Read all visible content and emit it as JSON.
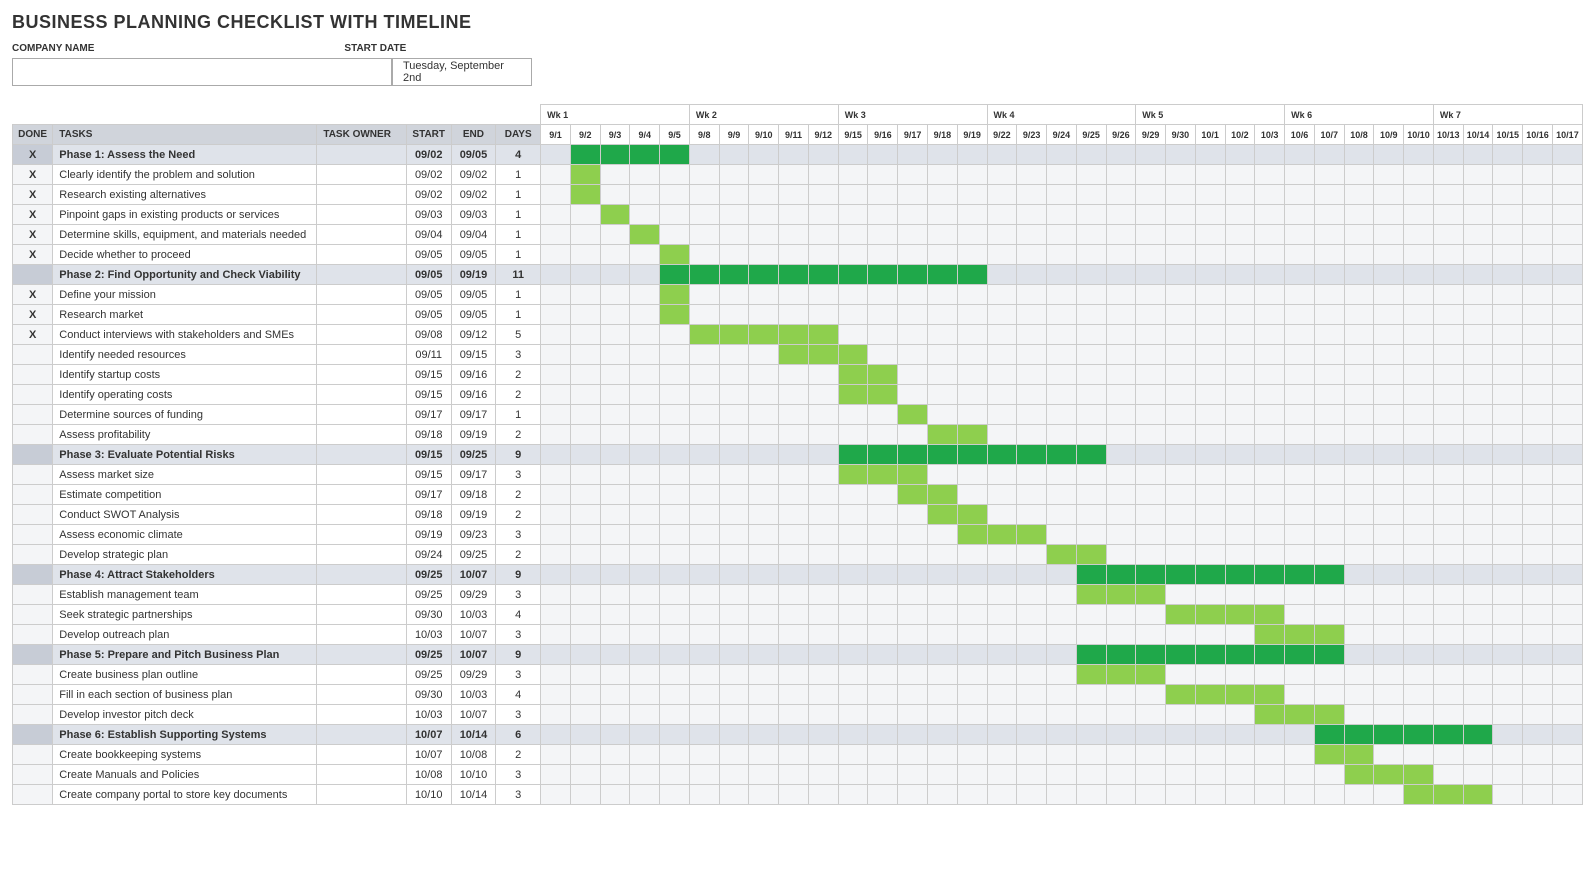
{
  "title": "BUSINESS PLANNING CHECKLIST WITH TIMELINE",
  "meta": {
    "company_label": "COMPANY NAME",
    "company_value": "",
    "startdate_label": "START DATE",
    "startdate_value": "Tuesday, September 2nd"
  },
  "headers": {
    "done": "DONE",
    "tasks": "TASKS",
    "owner": "TASK OWNER",
    "start": "START",
    "end": "END",
    "days": "DAYS"
  },
  "weeks": [
    {
      "label": "Wk 1",
      "days": [
        "9/1",
        "9/2",
        "9/3",
        "9/4",
        "9/5"
      ]
    },
    {
      "label": "Wk 2",
      "days": [
        "9/8",
        "9/9",
        "9/10",
        "9/11",
        "9/12"
      ]
    },
    {
      "label": "Wk 3",
      "days": [
        "9/15",
        "9/16",
        "9/17",
        "9/18",
        "9/19"
      ]
    },
    {
      "label": "Wk 4",
      "days": [
        "9/22",
        "9/23",
        "9/24",
        "9/25",
        "9/26"
      ]
    },
    {
      "label": "Wk 5",
      "days": [
        "9/29",
        "9/30",
        "10/1",
        "10/2",
        "10/3"
      ]
    },
    {
      "label": "Wk 6",
      "days": [
        "10/6",
        "10/7",
        "10/8",
        "10/9",
        "10/10"
      ]
    },
    {
      "label": "Wk 7",
      "days": [
        "10/13",
        "10/14",
        "10/15",
        "10/16",
        "10/17"
      ]
    }
  ],
  "all_days": [
    "9/1",
    "9/2",
    "9/3",
    "9/4",
    "9/5",
    "9/8",
    "9/9",
    "9/10",
    "9/11",
    "9/12",
    "9/15",
    "9/16",
    "9/17",
    "9/18",
    "9/19",
    "9/22",
    "9/23",
    "9/24",
    "9/25",
    "9/26",
    "9/29",
    "9/30",
    "10/1",
    "10/2",
    "10/3",
    "10/6",
    "10/7",
    "10/8",
    "10/9",
    "10/10",
    "10/13",
    "10/14",
    "10/15",
    "10/16",
    "10/17"
  ],
  "rows": [
    {
      "phase": true,
      "done": "X",
      "task": "Phase 1: Assess the Need",
      "owner": "",
      "start": "09/02",
      "end": "09/05",
      "days": "4",
      "bar_from": "9/2",
      "bar_to": "9/5"
    },
    {
      "phase": false,
      "done": "X",
      "task": "Clearly identify the problem and solution",
      "owner": "",
      "start": "09/02",
      "end": "09/02",
      "days": "1",
      "bar_from": "9/2",
      "bar_to": "9/2"
    },
    {
      "phase": false,
      "done": "X",
      "task": "Research existing alternatives",
      "owner": "",
      "start": "09/02",
      "end": "09/02",
      "days": "1",
      "bar_from": "9/2",
      "bar_to": "9/2"
    },
    {
      "phase": false,
      "done": "X",
      "task": "Pinpoint gaps in existing products or services",
      "owner": "",
      "start": "09/03",
      "end": "09/03",
      "days": "1",
      "bar_from": "9/3",
      "bar_to": "9/3"
    },
    {
      "phase": false,
      "done": "X",
      "task": "Determine skills, equipment, and materials needed",
      "owner": "",
      "start": "09/04",
      "end": "09/04",
      "days": "1",
      "bar_from": "9/4",
      "bar_to": "9/4"
    },
    {
      "phase": false,
      "done": "X",
      "task": "Decide whether to proceed",
      "owner": "",
      "start": "09/05",
      "end": "09/05",
      "days": "1",
      "bar_from": "9/5",
      "bar_to": "9/5"
    },
    {
      "phase": true,
      "done": "",
      "task": "Phase 2: Find Opportunity and Check Viability",
      "owner": "",
      "start": "09/05",
      "end": "09/19",
      "days": "11",
      "bar_from": "9/5",
      "bar_to": "9/19"
    },
    {
      "phase": false,
      "done": "X",
      "task": "Define your mission",
      "owner": "",
      "start": "09/05",
      "end": "09/05",
      "days": "1",
      "bar_from": "9/5",
      "bar_to": "9/5"
    },
    {
      "phase": false,
      "done": "X",
      "task": "Research market",
      "owner": "",
      "start": "09/05",
      "end": "09/05",
      "days": "1",
      "bar_from": "9/5",
      "bar_to": "9/5"
    },
    {
      "phase": false,
      "done": "X",
      "task": "Conduct interviews with stakeholders and SMEs",
      "owner": "",
      "start": "09/08",
      "end": "09/12",
      "days": "5",
      "bar_from": "9/8",
      "bar_to": "9/12"
    },
    {
      "phase": false,
      "done": "",
      "task": "Identify needed resources",
      "owner": "",
      "start": "09/11",
      "end": "09/15",
      "days": "3",
      "bar_from": "9/11",
      "bar_to": "9/15"
    },
    {
      "phase": false,
      "done": "",
      "task": "Identify startup costs",
      "owner": "",
      "start": "09/15",
      "end": "09/16",
      "days": "2",
      "bar_from": "9/15",
      "bar_to": "9/16"
    },
    {
      "phase": false,
      "done": "",
      "task": "Identify operating costs",
      "owner": "",
      "start": "09/15",
      "end": "09/16",
      "days": "2",
      "bar_from": "9/15",
      "bar_to": "9/16"
    },
    {
      "phase": false,
      "done": "",
      "task": "Determine sources of funding",
      "owner": "",
      "start": "09/17",
      "end": "09/17",
      "days": "1",
      "bar_from": "9/17",
      "bar_to": "9/17"
    },
    {
      "phase": false,
      "done": "",
      "task": "Assess profitability",
      "owner": "",
      "start": "09/18",
      "end": "09/19",
      "days": "2",
      "bar_from": "9/18",
      "bar_to": "9/19"
    },
    {
      "phase": true,
      "done": "",
      "task": "Phase 3: Evaluate Potential Risks",
      "owner": "",
      "start": "09/15",
      "end": "09/25",
      "days": "9",
      "bar_from": "9/15",
      "bar_to": "9/25"
    },
    {
      "phase": false,
      "done": "",
      "task": "Assess market size",
      "owner": "",
      "start": "09/15",
      "end": "09/17",
      "days": "3",
      "bar_from": "9/15",
      "bar_to": "9/17"
    },
    {
      "phase": false,
      "done": "",
      "task": "Estimate competition",
      "owner": "",
      "start": "09/17",
      "end": "09/18",
      "days": "2",
      "bar_from": "9/17",
      "bar_to": "9/18"
    },
    {
      "phase": false,
      "done": "",
      "task": "Conduct SWOT Analysis",
      "owner": "",
      "start": "09/18",
      "end": "09/19",
      "days": "2",
      "bar_from": "9/18",
      "bar_to": "9/19"
    },
    {
      "phase": false,
      "done": "",
      "task": "Assess economic climate",
      "owner": "",
      "start": "09/19",
      "end": "09/23",
      "days": "3",
      "bar_from": "9/19",
      "bar_to": "9/23"
    },
    {
      "phase": false,
      "done": "",
      "task": "Develop strategic plan",
      "owner": "",
      "start": "09/24",
      "end": "09/25",
      "days": "2",
      "bar_from": "9/24",
      "bar_to": "9/25"
    },
    {
      "phase": true,
      "done": "",
      "task": "Phase 4: Attract Stakeholders",
      "owner": "",
      "start": "09/25",
      "end": "10/07",
      "days": "9",
      "bar_from": "9/25",
      "bar_to": "10/7"
    },
    {
      "phase": false,
      "done": "",
      "task": "Establish management team",
      "owner": "",
      "start": "09/25",
      "end": "09/29",
      "days": "3",
      "bar_from": "9/25",
      "bar_to": "9/29"
    },
    {
      "phase": false,
      "done": "",
      "task": "Seek strategic partnerships",
      "owner": "",
      "start": "09/30",
      "end": "10/03",
      "days": "4",
      "bar_from": "9/30",
      "bar_to": "10/3"
    },
    {
      "phase": false,
      "done": "",
      "task": "Develop outreach plan",
      "owner": "",
      "start": "10/03",
      "end": "10/07",
      "days": "3",
      "bar_from": "10/3",
      "bar_to": "10/7"
    },
    {
      "phase": true,
      "done": "",
      "task": "Phase 5: Prepare and Pitch Business Plan",
      "owner": "",
      "start": "09/25",
      "end": "10/07",
      "days": "9",
      "bar_from": "9/25",
      "bar_to": "10/7"
    },
    {
      "phase": false,
      "done": "",
      "task": "Create business plan outline",
      "owner": "",
      "start": "09/25",
      "end": "09/29",
      "days": "3",
      "bar_from": "9/25",
      "bar_to": "9/29"
    },
    {
      "phase": false,
      "done": "",
      "task": "Fill in each section of business plan",
      "owner": "",
      "start": "09/30",
      "end": "10/03",
      "days": "4",
      "bar_from": "9/30",
      "bar_to": "10/3"
    },
    {
      "phase": false,
      "done": "",
      "task": "Develop investor pitch deck",
      "owner": "",
      "start": "10/03",
      "end": "10/07",
      "days": "3",
      "bar_from": "10/3",
      "bar_to": "10/7"
    },
    {
      "phase": true,
      "done": "",
      "task": "Phase 6: Establish Supporting Systems",
      "owner": "",
      "start": "10/07",
      "end": "10/14",
      "days": "6",
      "bar_from": "10/7",
      "bar_to": "10/14"
    },
    {
      "phase": false,
      "done": "",
      "task": "Create bookkeeping systems",
      "owner": "",
      "start": "10/07",
      "end": "10/08",
      "days": "2",
      "bar_from": "10/7",
      "bar_to": "10/8"
    },
    {
      "phase": false,
      "done": "",
      "task": "Create Manuals and Policies",
      "owner": "",
      "start": "10/08",
      "end": "10/10",
      "days": "3",
      "bar_from": "10/8",
      "bar_to": "10/10"
    },
    {
      "phase": false,
      "done": "",
      "task": "Create company portal to store key documents",
      "owner": "",
      "start": "10/10",
      "end": "10/14",
      "days": "3",
      "bar_from": "10/10",
      "bar_to": "10/14"
    }
  ]
}
